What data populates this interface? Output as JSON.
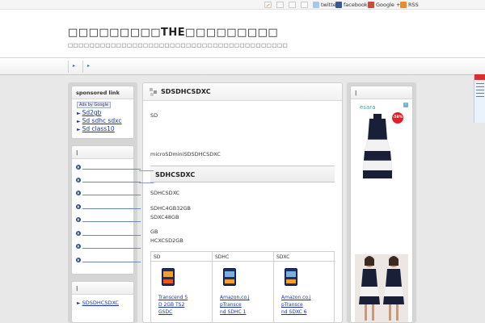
{
  "social": {
    "twitter": "twitter",
    "facebook": "facebook",
    "google": "Google +1",
    "rss": "RSS"
  },
  "header": {
    "title": "□□□□□□□□□THE□□□□□□□□□",
    "description": "□□□□□□□□□□□□□□□□□□□□□□□□□□□□□□□□□□□□□□□□□"
  },
  "nav": {
    "arrows": [
      "▸",
      "▸"
    ]
  },
  "sidebar_left": {
    "sponsored_heading": "sponsored link",
    "ads_label": "Ads by Google",
    "ad_links": [
      "Sd2gb",
      "Sd sdhc sdxc",
      "Sd class10"
    ],
    "widget2_heading": "|",
    "widget3_heading": "|",
    "recent_post": "SDSDHCSDXC"
  },
  "main": {
    "title": "SDSDHCSDXC",
    "p1": "SD",
    "p2": "microSDminiSDSDHCSDXC",
    "h2": "SDHCSDXC",
    "p3": "SDHCSDXC",
    "p4": "SDHC4GB32GB",
    "p5": "SDXC48GB",
    "p6": "GB",
    "p7": "HCXCSD2GB",
    "table": {
      "headers": [
        "SD",
        "SDHC",
        "SDXC"
      ],
      "products": [
        {
          "card_label": "2GB",
          "lines": [
            "Transcend S",
            "D 2GB    TS2",
            "GSDC"
          ]
        },
        {
          "card_label": "16GB",
          "lines": [
            "Amazon.co.j",
            "pTransce",
            "nd SDHC 1"
          ]
        },
        {
          "card_label": "64GB",
          "lines": [
            "Amazon.co.j",
            "pTransce",
            "nd SDXC 6"
          ]
        }
      ]
    }
  },
  "sidebar_right": {
    "heading": "|",
    "brand": "esara",
    "badge": "-58%"
  },
  "colors": {
    "link": "#1a33aa",
    "accent": "#2f4f8f",
    "badge": "#e0212a"
  }
}
